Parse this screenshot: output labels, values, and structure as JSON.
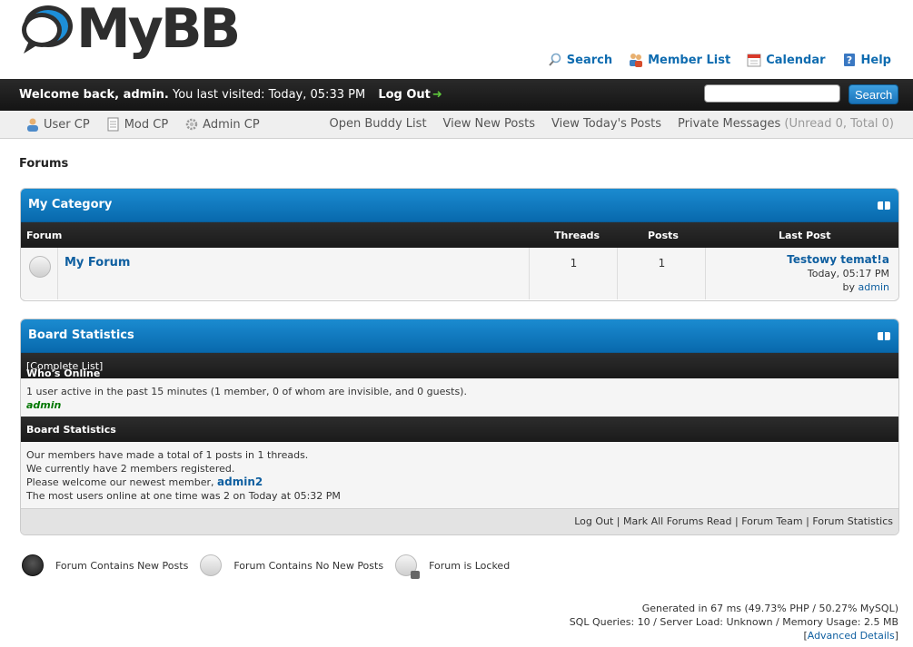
{
  "header": {
    "logo_text": "MyBB",
    "top_links": [
      {
        "label": "Search",
        "icon": "magnifier-icon"
      },
      {
        "label": "Member List",
        "icon": "members-icon"
      },
      {
        "label": "Calendar",
        "icon": "calendar-icon"
      },
      {
        "label": "Help",
        "icon": "help-icon"
      }
    ]
  },
  "welcome": {
    "greeting": "Welcome back, admin.",
    "last_visit": "You last visited: Today, 05:33 PM",
    "logout": "Log Out",
    "search_placeholder": "",
    "search_button": "Search"
  },
  "panel": {
    "left": [
      {
        "label": "User CP"
      },
      {
        "label": "Mod CP"
      },
      {
        "label": "Admin CP"
      }
    ],
    "right": {
      "buddy": "Open Buddy List",
      "new_posts": "View New Posts",
      "todays_posts": "View Today's Posts",
      "pm": "Private Messages",
      "pm_count": "(Unread 0, Total 0)"
    }
  },
  "breadcrumb": "Forums",
  "category": {
    "title": "My Category",
    "columns": {
      "forum": "Forum",
      "threads": "Threads",
      "posts": "Posts",
      "last_post": "Last Post"
    },
    "forums": [
      {
        "name": "My Forum",
        "threads": "1",
        "posts": "1",
        "last_post_title": "Testowy temat!a",
        "last_post_time": "Today, 05:17 PM",
        "last_post_by": "by",
        "last_post_user": "admin"
      }
    ]
  },
  "stats": {
    "title": "Board Statistics",
    "whos_online": {
      "heading": "Who's Online",
      "complete_list": "[Complete List]",
      "text": "1 user active in the past 15 minutes (1 member, 0 of whom are invisible, and 0 guests).",
      "users": "admin"
    },
    "board": {
      "heading": "Board Statistics",
      "line1": "Our members have made a total of 1 posts in 1 threads.",
      "line2": "We currently have 2 members registered.",
      "line3_prefix": "Please welcome our newest member,",
      "newest_member": "admin2",
      "line4": "The most users online at one time was 2 on Today at 05:32 PM"
    },
    "footer_links": [
      "Log Out",
      "Mark All Forums Read",
      "Forum Team",
      "Forum Statistics"
    ]
  },
  "legend": [
    {
      "label": "Forum Contains New Posts",
      "icon": "forum-new-icon"
    },
    {
      "label": "Forum Contains No New Posts",
      "icon": "forum-old-icon"
    },
    {
      "label": "Forum is Locked",
      "icon": "forum-locked-icon"
    }
  ],
  "debug": {
    "line1": "Generated in 67 ms (49.73% PHP / 50.27% MySQL)",
    "line2": "SQL Queries: 10 / Server Load: Unknown / Memory Usage: 2.5 MB",
    "details_open": "[",
    "details_link": "Advanced Details",
    "details_close": "]"
  },
  "colors": {
    "accent": "#0f6cb0",
    "header_dark": "#1e1e1e",
    "table_head": "#0d76bb",
    "online_user": "#007700"
  }
}
